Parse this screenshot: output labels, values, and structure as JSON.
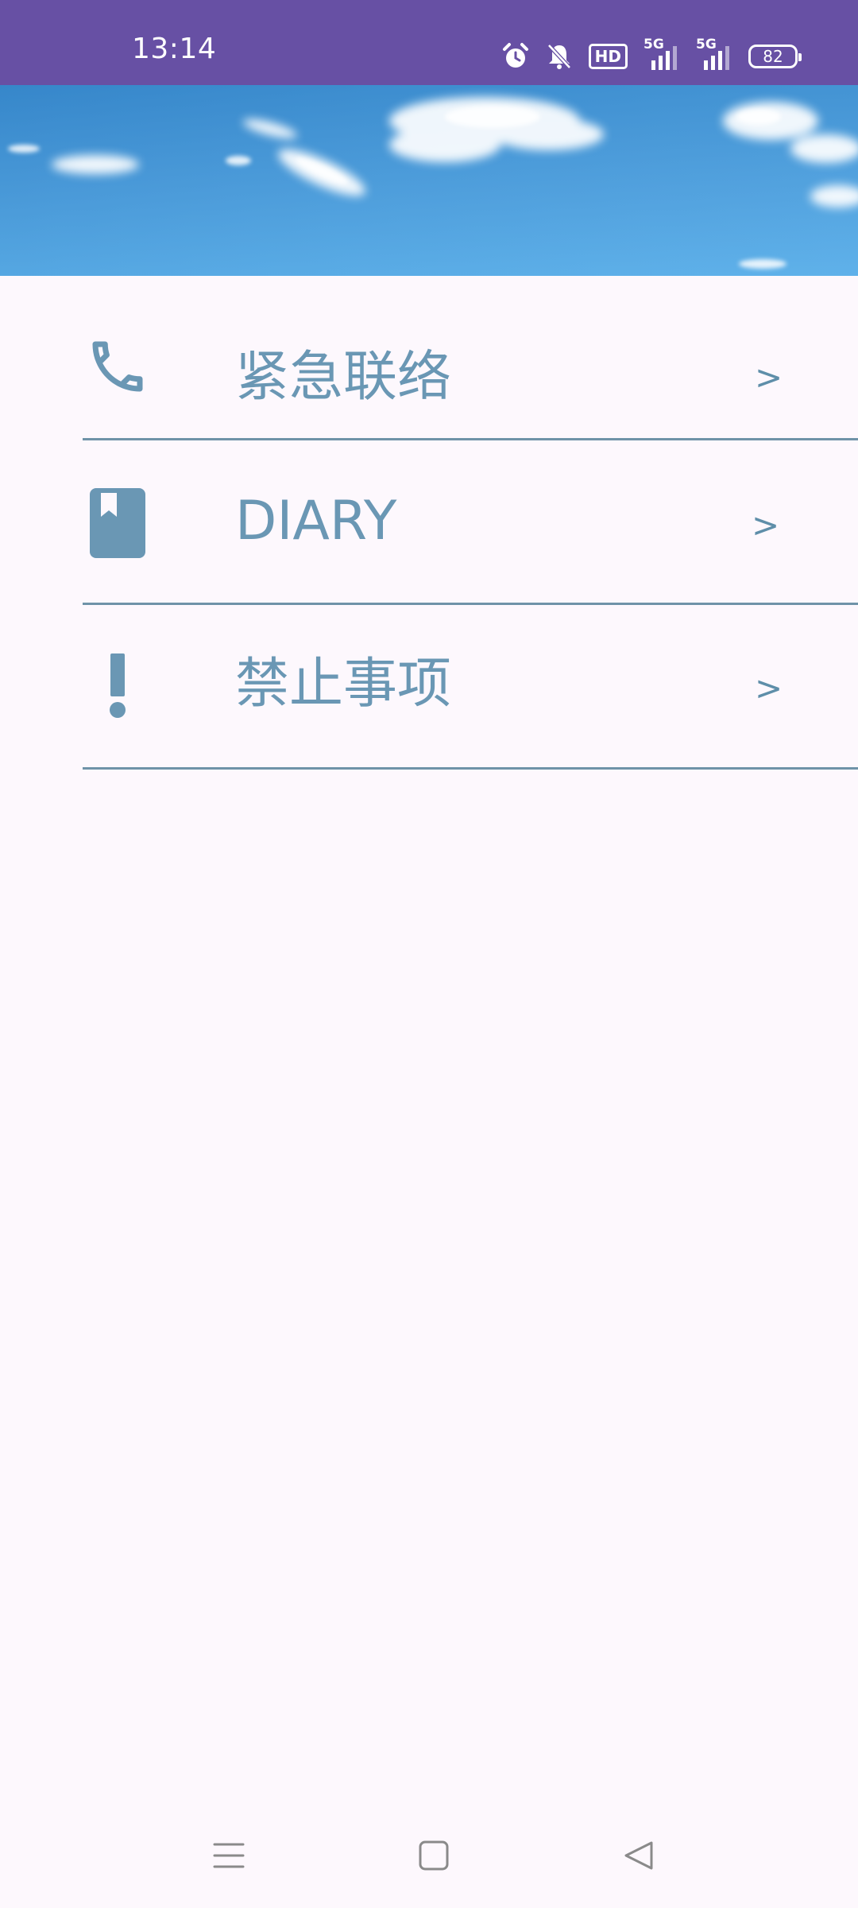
{
  "status_bar": {
    "time": "13:14",
    "hd_label": "HD",
    "network_1_label": "5G",
    "network_2_label": "5G",
    "battery_level": "82"
  },
  "banner": {
    "description_icon": "sky-banner-image"
  },
  "menu": {
    "items": [
      {
        "icon": "phone-icon",
        "label": "紧急联络",
        "arrow": ">"
      },
      {
        "icon": "book-icon",
        "label": "DIARY",
        "arrow": ">"
      },
      {
        "icon": "exclamation-icon",
        "label": "禁止事项",
        "arrow": ">"
      }
    ]
  },
  "colors": {
    "status_bar": "#6750a4",
    "background": "#fdf8fd",
    "accent": "#6a97b4",
    "divider": "#6f93a8"
  }
}
